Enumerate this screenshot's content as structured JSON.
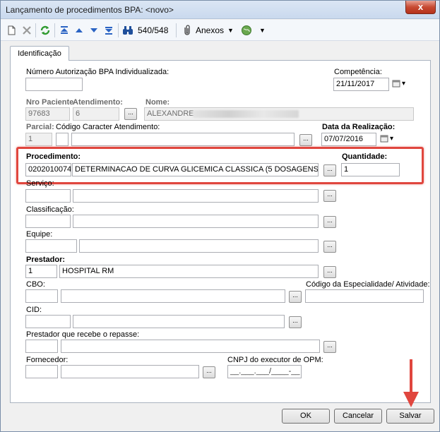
{
  "window": {
    "title": "Lançamento de procedimentos BPA: <novo>",
    "close_label": "x"
  },
  "toolbar": {
    "counter": "540/548",
    "attachments_label": "Anexos"
  },
  "tabs": [
    {
      "label": "Identificação"
    }
  ],
  "form": {
    "autorizacao": {
      "label": "Número Autorização BPA Individualizada:",
      "value": ""
    },
    "competencia": {
      "label": "Competência:",
      "value": "21/11/2017"
    },
    "nro_paciente": {
      "label": "Nro Paciente",
      "value": "97683"
    },
    "atendimento": {
      "label": "Atendimento:",
      "value": "6"
    },
    "nome": {
      "label": "Nome:",
      "value": "ALEXANDRE"
    },
    "parcial": {
      "label": "Parcial:",
      "value": "1"
    },
    "codigo_caracter": {
      "label": "Código Caracter Atendimento:",
      "code": "",
      "description": ""
    },
    "data_realizacao": {
      "label": "Data da Realização:",
      "value": "07/07/2016"
    },
    "procedimento": {
      "label": "Procedimento:",
      "code": "0202010074",
      "description": "DETERMINACAO DE CURVA GLICEMICA CLASSICA (5 DOSAGENS)"
    },
    "quantidade": {
      "label": "Quantidade:",
      "value": "1"
    },
    "servico": {
      "label": "Serviço:"
    },
    "classificacao": {
      "label": "Classificação:"
    },
    "equipe": {
      "label": "Equipe:"
    },
    "prestador": {
      "label": "Prestador:",
      "code": "1",
      "description": "HOSPITAL RM"
    },
    "cbo": {
      "label": "CBO:"
    },
    "especialidade": {
      "label": "Código da Especialidade/ Atividade:"
    },
    "cid": {
      "label": "CID:"
    },
    "prestador_repasse": {
      "label": "Prestador que recebe o repasse:"
    },
    "fornecedor": {
      "label": "Fornecedor:"
    },
    "cnpj_opm": {
      "label": "CNPJ do executor de OPM:",
      "placeholder": "__.___.___/____-__"
    }
  },
  "buttons": {
    "ok": "OK",
    "cancel": "Cancelar",
    "save": "Salvar"
  },
  "colors": {
    "highlight": "#e0463e",
    "titlebar": "#c9d9ee"
  }
}
